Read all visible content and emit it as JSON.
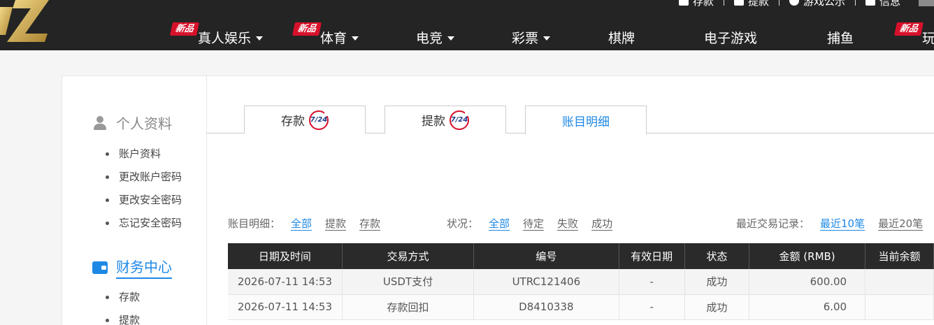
{
  "header": {
    "util": [
      {
        "icon": "card-icon",
        "label": "存款"
      },
      {
        "icon": "wallet-icon",
        "label": "提款"
      },
      {
        "icon": "user-circle-icon",
        "label": "游戏公示"
      },
      {
        "icon": "mail-icon",
        "label": "信息"
      }
    ],
    "new_badge": "新品",
    "nav": [
      {
        "label": "真人娱乐",
        "dropdown": true,
        "new": true
      },
      {
        "label": "体育",
        "dropdown": true,
        "new": true
      },
      {
        "label": "电竞",
        "dropdown": true,
        "new": false
      },
      {
        "label": "彩票",
        "dropdown": true,
        "new": false
      },
      {
        "label": "棋牌",
        "dropdown": false,
        "new": false
      },
      {
        "label": "电子游戏",
        "dropdown": false,
        "new": false
      },
      {
        "label": "捕鱼",
        "dropdown": false,
        "new": false
      },
      {
        "label": "玩",
        "dropdown": false,
        "new": true
      }
    ]
  },
  "sidebar": {
    "personal": {
      "title": "个人资料",
      "items": [
        "账户资料",
        "更改账户密码",
        "更改安全密码",
        "忘记安全密码"
      ]
    },
    "finance": {
      "title": "财务中心",
      "items": [
        "存款",
        "提款"
      ]
    }
  },
  "tabs": [
    {
      "label": "存款",
      "badge": "7/24",
      "active": false
    },
    {
      "label": "提款",
      "badge": "7/24",
      "active": false
    },
    {
      "label": "账目明细",
      "badge": "",
      "active": true
    }
  ],
  "filters": {
    "type": {
      "label": "账目明细：",
      "options": [
        "全部",
        "提款",
        "存款"
      ],
      "selected": "全部"
    },
    "status": {
      "label": "状况：",
      "options": [
        "全部",
        "待定",
        "失败",
        "成功"
      ],
      "selected": "全部"
    },
    "recent": {
      "label": "最近交易记录：",
      "options": [
        "最近10笔",
        "最近20笔"
      ],
      "selected": "最近10笔"
    }
  },
  "table": {
    "columns": [
      "日期及时间",
      "交易方式",
      "编号",
      "有效日期",
      "状态",
      "金额 (RMB)",
      "当前余额"
    ],
    "rows": [
      [
        "2026-07-11 14:53",
        "USDT支付",
        "UTRC121406",
        "-",
        "成功",
        "600.00",
        ""
      ],
      [
        "2026-07-11 14:53",
        "存款回扣",
        "D8410338",
        "-",
        "成功",
        "6.00",
        ""
      ]
    ]
  },
  "colors": {
    "accent": "#1e88e5",
    "header_bg": "#242424",
    "badge_red": "#d8112b",
    "logo_gold": "#c9a646"
  }
}
